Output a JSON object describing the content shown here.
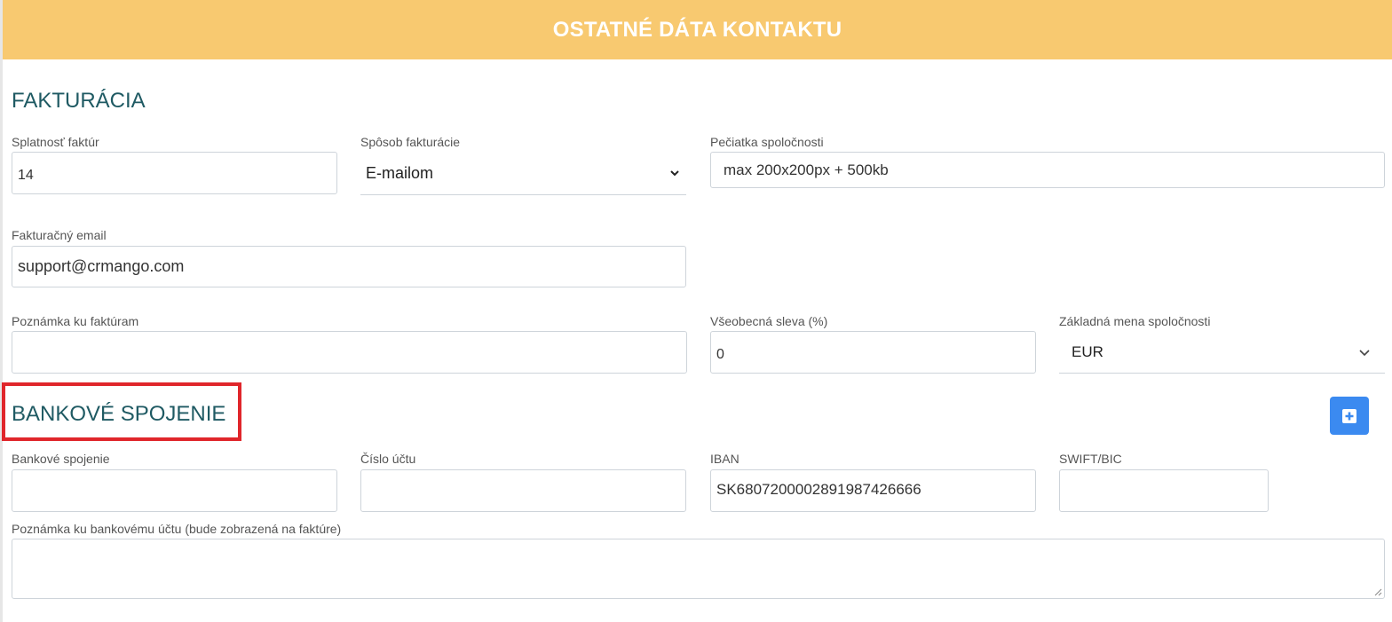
{
  "header": {
    "title": "OSTATNÉ DÁTA KONTAKTU"
  },
  "billing": {
    "title": "FAKTURÁCIA",
    "due_label": "Splatnosť faktúr",
    "due_value": "14",
    "method_label": "Spôsob fakturácie",
    "method_value": "E-mailom",
    "stamp_label": "Pečiatka spoločnosti",
    "stamp_value": "max 200x200px + 500kb",
    "email_label": "Fakturačný email",
    "email_value": "support@crmango.com",
    "note_label": "Poznámka ku faktúram",
    "note_value": "",
    "discount_label": "Všeobecná sleva (%)",
    "discount_value": "0",
    "currency_label": "Základná mena spoločnosti",
    "currency_value": "EUR"
  },
  "bank": {
    "title": "BANKOVÉ SPOJENIE",
    "bank_label": "Bankové spojenie",
    "bank_value": "",
    "account_label": "Číslo účtu",
    "account_value": "",
    "iban_label": "IBAN",
    "iban_value": "SK6807200002891987426666",
    "swift_label": "SWIFT/BIC",
    "swift_value": "",
    "note_label": "Poznámka ku bankovému účtu (bude zobrazená na faktúre)",
    "note_value": "",
    "add_button_icon": "plus-square-icon"
  },
  "colors": {
    "header_bg": "#f8c970",
    "section_title": "#1f5a63",
    "highlight": "#e0262b",
    "button_bg": "#3b8af0"
  }
}
